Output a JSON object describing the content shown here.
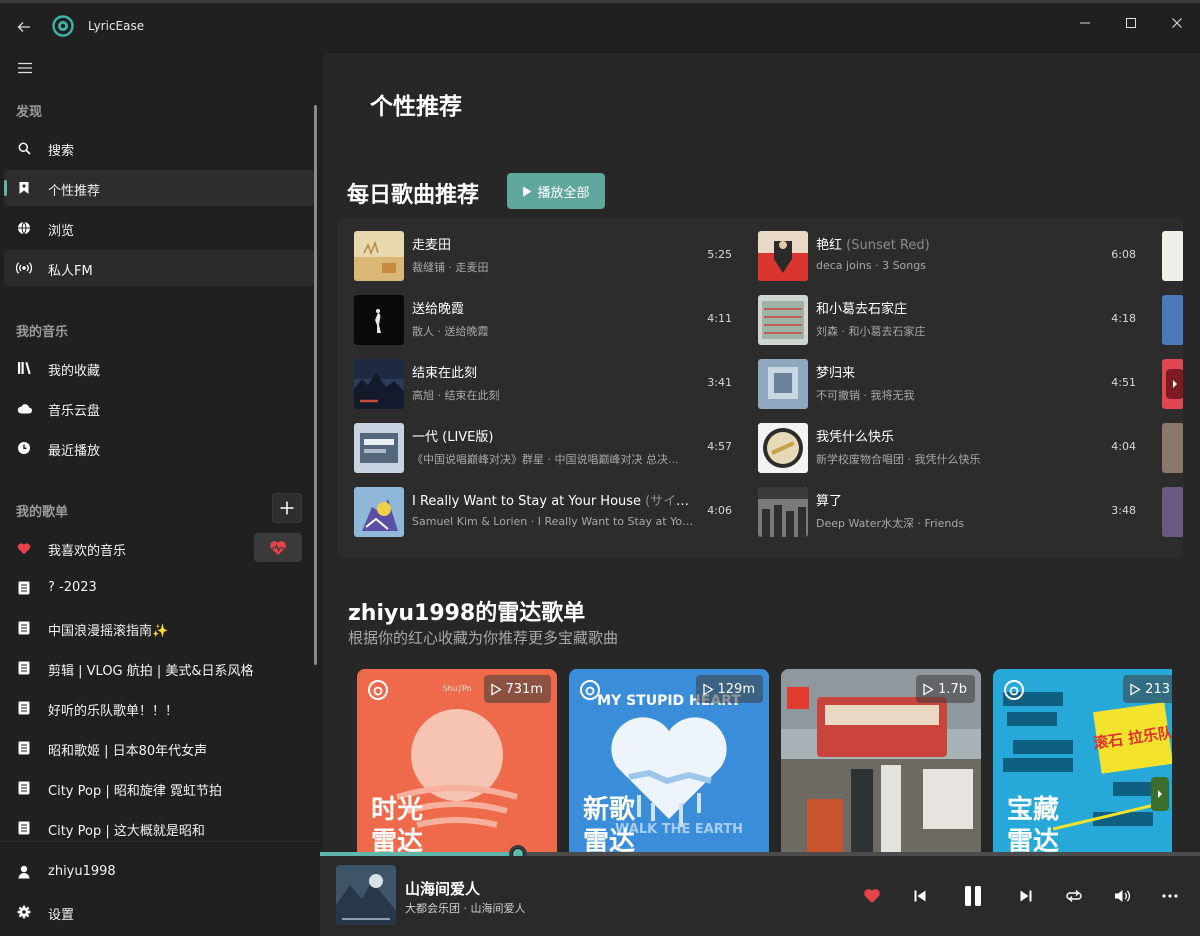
{
  "app": {
    "title": "LyricEase"
  },
  "sidebar": {
    "sections": {
      "discover": "发现",
      "my_music": "我的音乐",
      "my_playlists": "我的歌单"
    },
    "discover_items": [
      {
        "label": "搜索",
        "icon": "search-icon"
      },
      {
        "label": "个性推荐",
        "icon": "bookmark-icon",
        "selected": true
      },
      {
        "label": "浏览",
        "icon": "globe-icon"
      },
      {
        "label": "私人FM",
        "icon": "radio-icon"
      }
    ],
    "my_music_items": [
      {
        "label": "我的收藏",
        "icon": "library-icon"
      },
      {
        "label": "音乐云盘",
        "icon": "cloud-icon"
      },
      {
        "label": "最近播放",
        "icon": "clock-icon"
      }
    ],
    "playlists": [
      "我喜欢的音乐",
      "? -2023",
      "中国浪漫摇滚指南✨",
      "剪辑 | VLOG 航拍 | 美式&日系风格",
      "好听的乐队歌单！！！",
      "昭和歌姬 | 日本80年代女声",
      "City Pop | 昭和旋律 霓虹节拍",
      "City Pop | 这大概就是昭和"
    ],
    "user": "zhiyu1998",
    "settings": "设置"
  },
  "main": {
    "page_title": "个性推荐",
    "daily": {
      "title": "每日歌曲推荐",
      "play_all": "播放全部",
      "songs": [
        {
          "name": "走麦田",
          "sub": "",
          "meta": "裁缝铺 · 走麦田",
          "duration": "5:25"
        },
        {
          "name": "送给晚霞",
          "sub": "",
          "meta": "散人 · 送给晚霞",
          "duration": "4:11"
        },
        {
          "name": "结束在此刻",
          "sub": "",
          "meta": "高旭 · 结束在此刻",
          "duration": "3:41"
        },
        {
          "name": "一代 (LIVE版)",
          "sub": "",
          "meta": "《中国说唱巅峰对决》群星 · 中国说唱巅峰对决 总决...",
          "duration": "4:57"
        },
        {
          "name": "I Really Want to Stay at Your House",
          "sub": " (サイバー...",
          "meta": "Samuel Kim & Lorien · I Really Want to Stay at Your Ho...",
          "duration": "4:06"
        },
        {
          "name": "艳红",
          "sub": " (Sunset Red)",
          "meta": "deca joins · 3 Songs",
          "duration": "6:08"
        },
        {
          "name": "和小葛去石家庄",
          "sub": "",
          "meta": "刘森 · 和小葛去石家庄",
          "duration": "4:18"
        },
        {
          "name": "梦归来",
          "sub": "",
          "meta": "不可撤销 · 我将无我",
          "duration": "4:51"
        },
        {
          "name": "我凭什么快乐",
          "sub": "",
          "meta": "新学校废物合唱团 · 我凭什么快乐",
          "duration": "4:04"
        },
        {
          "name": "算了",
          "sub": "",
          "meta": "Deep Water水太深 · Friends",
          "duration": "3:48"
        }
      ]
    },
    "radar": {
      "title": "zhiyu1998的雷达歌单",
      "subtitle": "根据你的红心收藏为你推荐更多宝藏歌曲",
      "cards": [
        {
          "plays": "731m",
          "line1": "时光",
          "line2": "雷达",
          "top_text": "Shu∫Po"
        },
        {
          "plays": "129m",
          "line1": "新歌",
          "line2": "雷达",
          "top_text": "MY STUPID HEART",
          "bottom_text": "WALK THE EARTH"
        },
        {
          "plays": "1.7b",
          "line1": "",
          "line2": ""
        },
        {
          "plays": "213",
          "line1": "宝藏",
          "line2": "雷达",
          "top_text": "滚石 拉乐队"
        }
      ]
    }
  },
  "player": {
    "title": "山海间爱人",
    "artist": "大都会乐团 · 山海间爱人",
    "progress": 0.225,
    "accent": "#5fb7ab",
    "liked_color": "#e8434b"
  }
}
